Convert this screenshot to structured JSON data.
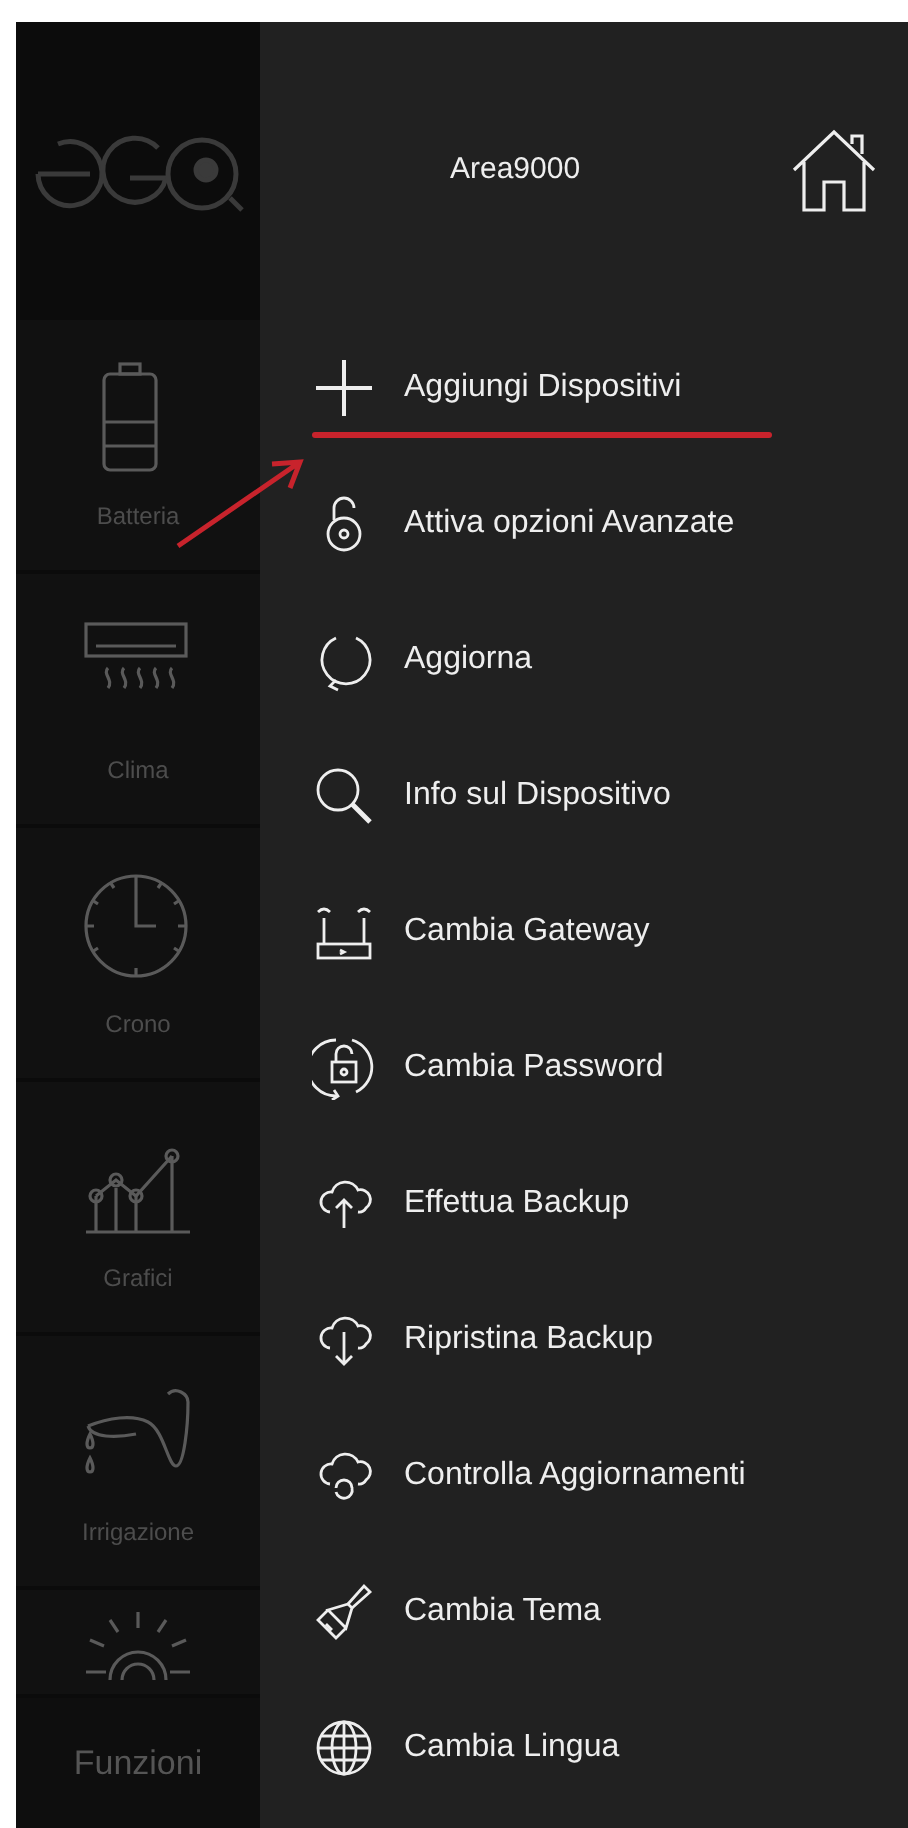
{
  "sidebar": {
    "items": [
      {
        "kind": "battery",
        "label": "Batteria"
      },
      {
        "kind": "aircon",
        "label": "Clima"
      },
      {
        "kind": "clock",
        "label": "Crono"
      },
      {
        "kind": "chart",
        "label": "Grafici"
      },
      {
        "kind": "watering",
        "label": "Irrigazione"
      },
      {
        "kind": "sun"
      }
    ],
    "footer": "Funzioni"
  },
  "drawer": {
    "title": "Area9000",
    "items": [
      {
        "kind": "plus",
        "label": "Aggiungi Dispositivi",
        "highlighted": true
      },
      {
        "kind": "padlock",
        "label": "Attiva opzioni Avanzate",
        "highlighted": false
      },
      {
        "kind": "refresh",
        "label": "Aggiorna",
        "highlighted": false
      },
      {
        "kind": "search",
        "label": "Info sul Dispositivo",
        "highlighted": false
      },
      {
        "kind": "router",
        "label": "Cambia Gateway",
        "highlighted": false
      },
      {
        "kind": "lockcycle",
        "label": "Cambia Password",
        "highlighted": false
      },
      {
        "kind": "cloudup",
        "label": "Effettua Backup",
        "highlighted": false
      },
      {
        "kind": "clouddown",
        "label": "Ripristina Backup",
        "highlighted": false
      },
      {
        "kind": "cloudsync",
        "label": "Controlla Aggiornamenti",
        "highlighted": false
      },
      {
        "kind": "brush",
        "label": "Cambia Tema",
        "highlighted": false
      },
      {
        "kind": "globe",
        "label": "Cambia Lingua",
        "highlighted": false
      }
    ]
  }
}
